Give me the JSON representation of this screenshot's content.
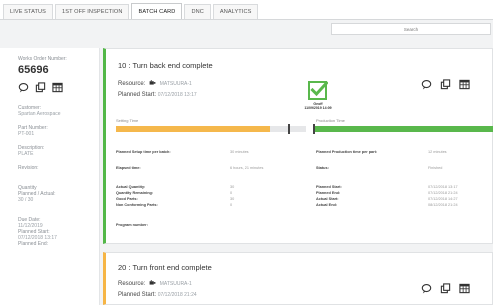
{
  "tabs": [
    "LIVE STATUS",
    "1ST OFF INSPECTION",
    "BATCH CARD",
    "DNC",
    "ANALYTICS"
  ],
  "search": {
    "placeholder": "Search"
  },
  "sidebar": {
    "works_order_label": "Works Order Number:",
    "works_order_number": "65696",
    "customer_label": "Customer:",
    "customer_value": "Spartan Aerospace",
    "part_number_label": "Part Number:",
    "part_number_value": "PT-001",
    "description_label": "Description:",
    "description_value": "PLATE",
    "revision_label": "Revision:",
    "revision_value": "",
    "quantity_label": "Quantity",
    "quantity_sub_label": "Planned / Actual:",
    "quantity_value": "30 / 30",
    "due_date_label": "Due Date:",
    "due_date_value": "11/12/2019",
    "planned_start_label": "Planned Start:",
    "planned_start_value": "07/12/2018 13:17",
    "planned_end_label": "Planned End:"
  },
  "operations": [
    {
      "title": "10 : Turn back end complete",
      "resource_label": "Resource:",
      "resource_value": "MATSUURA-1",
      "planned_start_label": "Planned Start:",
      "planned_start_value": "07/12/2018 13:17",
      "done_by": "Geoff",
      "done_at": "11/09/2019 14:09",
      "setup_label": "Setting Time",
      "production_label": "Production Time",
      "setup_progress": 0.81,
      "production_progress": 1.0,
      "colors": {
        "accent": "#53b848",
        "setup": "#f5b84c",
        "production": "#59b84c"
      },
      "details_left": [
        {
          "k": "Planned Setup time per batch:",
          "v": "30 minutes"
        },
        {
          "k": "Elapsed time:",
          "v": "6 hours, 21 minutes"
        },
        {
          "k": "Actual Quantity:",
          "v": "30"
        },
        {
          "k": "Quantity Remaining:",
          "v": "0"
        },
        {
          "k": "Good Parts:",
          "v": "30"
        },
        {
          "k": "Non Conforming Parts:",
          "v": "0"
        },
        {
          "k": "Program number:",
          "v": ""
        }
      ],
      "details_right": [
        {
          "k": "Planned Production time per part:",
          "v": "12 minutes"
        },
        {
          "k": "Status:",
          "v": "Finished"
        },
        {
          "k": "Planned Start:",
          "v": "07/12/2018 13:17"
        },
        {
          "k": "Planned End:",
          "v": "07/12/2018 21:24"
        },
        {
          "k": "Actual Start:",
          "v": "07/12/2018 14:27"
        },
        {
          "k": "Actual End:",
          "v": "08/12/2018 21:24"
        }
      ]
    },
    {
      "title": "20 : Turn front end complete",
      "resource_label": "Resource:",
      "resource_value": "MATSUURA-1",
      "planned_start_label": "Planned Start:",
      "planned_start_value": "07/12/2018 21:24",
      "colors": {
        "accent": "#f6b545"
      }
    }
  ],
  "icons": [
    "comment-icon",
    "copy-icon",
    "table-icon",
    "robot-icon",
    "checkmark-icon"
  ]
}
